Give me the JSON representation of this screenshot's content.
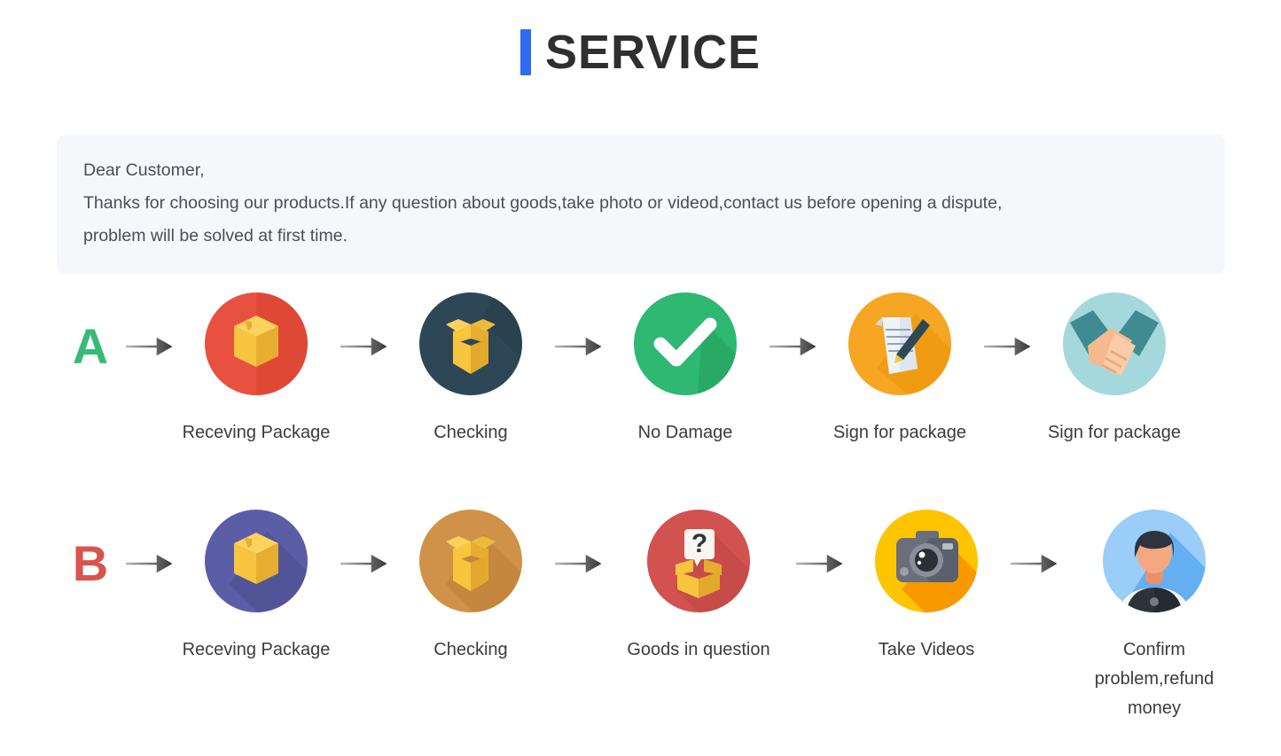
{
  "header": {
    "title": "SERVICE",
    "accent_color": "#2f6af5"
  },
  "notice": {
    "line1": "Dear Customer,",
    "line2": "Thanks for choosing our products.If any question about goods,take photo or videod,contact us before opening a dispute,",
    "line3": "problem will be solved at first time.",
    "background_color": "#f5f7fa",
    "text_color": "#4a4f57"
  },
  "flows": [
    {
      "letter": "A",
      "letter_color": "#35bb77",
      "steps": [
        {
          "label": "Receving Package",
          "icon": "package-box-icon",
          "circle_color": "#e8513f"
        },
        {
          "label": "Checking",
          "icon": "open-box-icon",
          "circle_color": "#2e4756"
        },
        {
          "label": "No Damage",
          "icon": "check-mark-icon",
          "circle_color": "#2eb872"
        },
        {
          "label": "Sign for package",
          "icon": "document-pen-icon",
          "circle_color": "#f6a623"
        },
        {
          "label": "Sign for package",
          "icon": "handshake-icon",
          "circle_color": "#a5d8dd"
        }
      ]
    },
    {
      "letter": "B",
      "letter_color": "#d9534f",
      "steps": [
        {
          "label": "Receving Package",
          "icon": "package-box-icon",
          "circle_color": "#5b5ea6"
        },
        {
          "label": "Checking",
          "icon": "open-box-icon",
          "circle_color": "#d09248"
        },
        {
          "label": "Goods in question",
          "icon": "question-box-icon",
          "circle_color": "#d2524f"
        },
        {
          "label": "Take Videos",
          "icon": "camera-icon",
          "circle_color": "#fdc500"
        },
        {
          "label": "Confirm  problem,refund\nmoney",
          "icon": "person-avatar-icon",
          "circle_color": "#9acdf7"
        }
      ]
    }
  ],
  "arrow": {
    "name": "right-arrow-icon",
    "color": "#4a4a4a"
  }
}
